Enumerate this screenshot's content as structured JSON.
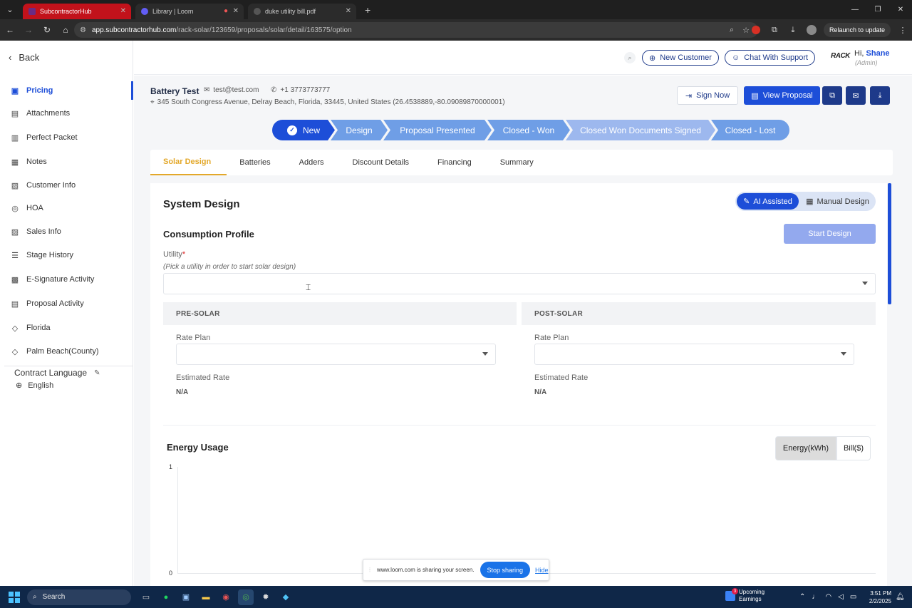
{
  "browser": {
    "tabs": [
      {
        "title": "SubcontractorHub",
        "active": true
      },
      {
        "title": "Library | Loom",
        "active": false
      },
      {
        "title": "duke utility bill.pdf",
        "active": false
      }
    ],
    "url_host": "app.subcontractorhub.com",
    "url_path": "/rack-solar/123659/proposals/solar/detail/163575/option",
    "relaunch_label": "Relaunch to update"
  },
  "sidebar": {
    "back_label": "Back",
    "items": [
      {
        "label": "Pricing",
        "icon": "tag-icon",
        "glyph": "▣",
        "active": true
      },
      {
        "label": "Attachments",
        "icon": "attachment-icon",
        "glyph": "▤"
      },
      {
        "label": "Perfect Packet",
        "icon": "packet-icon",
        "glyph": "▥"
      },
      {
        "label": "Notes",
        "icon": "notes-icon",
        "glyph": "▦"
      },
      {
        "label": "Customer Info",
        "icon": "id-card-icon",
        "glyph": "▧"
      },
      {
        "label": "HOA",
        "icon": "check-circle-icon",
        "glyph": "◎"
      },
      {
        "label": "Sales Info",
        "icon": "sales-icon",
        "glyph": "▨"
      },
      {
        "label": "Stage History",
        "icon": "history-icon",
        "glyph": "☰"
      },
      {
        "label": "E-Signature Activity",
        "icon": "signature-icon",
        "glyph": "▩"
      },
      {
        "label": "Proposal Activity",
        "icon": "proposal-icon",
        "glyph": "▤"
      },
      {
        "label": "Florida",
        "icon": "location-icon",
        "glyph": "◇"
      },
      {
        "label": "Palm Beach(County)",
        "icon": "location-icon",
        "glyph": "◇"
      }
    ],
    "contract_language_label": "Contract Language",
    "language_value": "English"
  },
  "header": {
    "new_customer_label": "New Customer",
    "chat_support_label": "Chat With Support",
    "logo_text": "RACK",
    "greeting": "Hi,",
    "user_name": "Shane",
    "user_role": "(Admin)"
  },
  "customer": {
    "name": "Battery Test",
    "email": "test@test.com",
    "phone": "+1 3773773777",
    "address": "345 South Congress Avenue, Delray Beach, Florida, 33445, United States (26.4538889,-80.09089870000001)"
  },
  "actions": {
    "sign_now": "Sign Now",
    "view_proposal": "View Proposal"
  },
  "stages": [
    {
      "label": "New",
      "state": "current"
    },
    {
      "label": "Design",
      "state": "next"
    },
    {
      "label": "Proposal Presented",
      "state": "next"
    },
    {
      "label": "Closed - Won",
      "state": "next"
    },
    {
      "label": "Closed Won Documents Signed",
      "state": "lite"
    },
    {
      "label": "Closed - Lost",
      "state": "next"
    }
  ],
  "tabs": [
    {
      "label": "Solar Design",
      "active": true
    },
    {
      "label": "Batteries"
    },
    {
      "label": "Adders"
    },
    {
      "label": "Discount Details"
    },
    {
      "label": "Financing"
    },
    {
      "label": "Summary"
    }
  ],
  "design": {
    "title": "System Design",
    "ai_assisted_label": "AI Assisted",
    "manual_design_label": "Manual Design",
    "consumption_title": "Consumption Profile",
    "start_design_label": "Start Design",
    "utility_label": "Utility",
    "utility_required": "*",
    "utility_hint": "(Pick a utility in order to start solar design)",
    "utility_value": "",
    "pre_solar": {
      "heading": "PRE-SOLAR",
      "rate_plan_label": "Rate Plan",
      "rate_plan_value": "",
      "estimated_rate_label": "Estimated Rate",
      "estimated_rate_value": "N/A"
    },
    "post_solar": {
      "heading": "POST-SOLAR",
      "rate_plan_label": "Rate Plan",
      "rate_plan_value": "",
      "estimated_rate_label": "Estimated Rate",
      "estimated_rate_value": "N/A"
    }
  },
  "energy": {
    "title": "Energy Usage",
    "toggle_energy": "Energy(kWh)",
    "toggle_bill": "Bill($)"
  },
  "chart_data": {
    "type": "bar",
    "categories": [],
    "values": [],
    "ylim": [
      0,
      1
    ],
    "y_ticks": [
      "1",
      "0"
    ]
  },
  "screen_share": {
    "message": "www.loom.com is sharing your screen.",
    "stop_label": "Stop sharing",
    "hide_label": "Hide"
  },
  "taskbar": {
    "search_label": "Search",
    "news_badge": "3",
    "news_title": "Upcoming",
    "news_sub": "Earnings",
    "time": "3:51 PM",
    "date": "2/2/2025"
  },
  "colors": {
    "primary": "#1d4ed8",
    "navy": "#1e3a8a",
    "accent_tab": "#e3a82a",
    "stage_next": "#6f9ee6",
    "brand_tab_red": "#c2121b"
  }
}
